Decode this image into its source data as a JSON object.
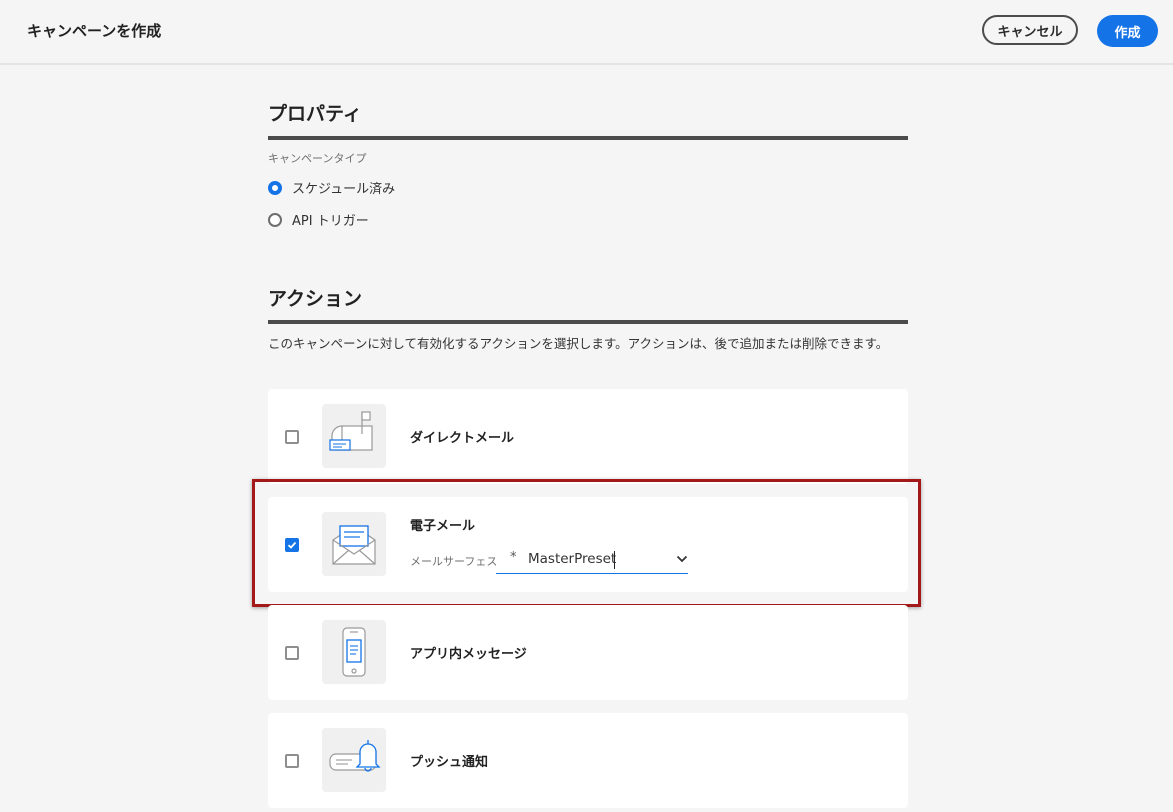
{
  "header": {
    "title": "キャンペーンを作成",
    "cancel_label": "キャンセル",
    "create_label": "作成"
  },
  "properties": {
    "title": "プロパティ",
    "campaign_type_label": "キャンペーンタイプ",
    "options": [
      {
        "label": "スケジュール済み",
        "selected": true
      },
      {
        "label": "API トリガー",
        "selected": false
      }
    ]
  },
  "actions": {
    "title": "アクション",
    "description": "このキャンペーンに対して有効化するアクションを選択します。アクションは、後で追加または削除できます。",
    "items": [
      {
        "label": "ダイレクトメール",
        "checked": false,
        "icon": "mailbox-icon"
      },
      {
        "label": "電子メール",
        "checked": true,
        "icon": "envelope-icon",
        "surface_label": "メールサーフェス",
        "surface_required": "*",
        "surface_value": "MasterPreset"
      },
      {
        "label": "アプリ内メッセージ",
        "checked": false,
        "icon": "phone-message-icon"
      },
      {
        "label": "プッシュ通知",
        "checked": false,
        "icon": "bell-icon"
      }
    ]
  },
  "colors": {
    "accent": "#1473e6",
    "highlight": "#a31919"
  }
}
